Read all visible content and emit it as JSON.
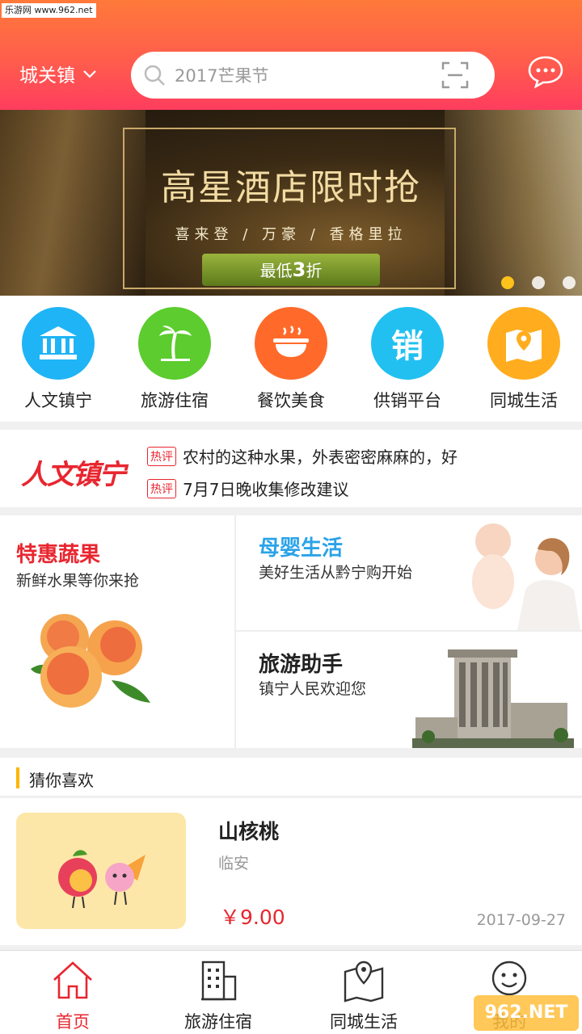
{
  "watermark_top": "乐游网 www.962.net",
  "header": {
    "city": "城关镇",
    "search_placeholder": "2017芒果节"
  },
  "banner": {
    "title": "高星酒店限时抢",
    "subtitle": "喜来登 / 万豪 / 香格里拉",
    "ribbon_prefix": "最低",
    "ribbon_num": "3",
    "ribbon_suffix": "折",
    "dots": 3,
    "active_dot": 1
  },
  "categories": [
    {
      "label": "人文镇宁",
      "icon": "bank-icon",
      "color": "#1fb4f5"
    },
    {
      "label": "旅游住宿",
      "icon": "palm-tree-icon",
      "color": "#5ccc2e"
    },
    {
      "label": "餐饮美食",
      "icon": "food-bowl-icon",
      "color": "#ff6a2a"
    },
    {
      "label": "供销平台",
      "icon": "sale-icon",
      "glyph": "销",
      "color": "#21c0f0"
    },
    {
      "label": "同城生活",
      "icon": "map-pin-icon",
      "color": "#ffad1f"
    }
  ],
  "news": {
    "brand": "人文镇宁",
    "items": [
      {
        "tag": "热评",
        "text": "农村的这种水果，外表密密麻麻的，好"
      },
      {
        "tag": "热评",
        "text": "7月7日晚收集修改建议"
      }
    ]
  },
  "promo": {
    "left": {
      "title": "特惠蔬果",
      "sub": "新鲜水果等你来抢",
      "title_color": "#e8262f"
    },
    "right_top": {
      "title": "母婴生活",
      "sub": "美好生活从黔宁购开始",
      "title_color": "#2aa3e8"
    },
    "right_bottom": {
      "title": "旅游助手",
      "sub": "镇宁人民欢迎您",
      "title_color": "#222222"
    }
  },
  "guess": {
    "label": "猜你喜欢"
  },
  "product": {
    "name": "山核桃",
    "location": "临安",
    "price": "￥9.00",
    "date": "2017-09-27"
  },
  "tabs": [
    {
      "label": "首页",
      "icon": "home-icon",
      "active": true
    },
    {
      "label": "旅游住宿",
      "icon": "building-icon",
      "active": false
    },
    {
      "label": "同城生活",
      "icon": "map-icon",
      "active": false
    },
    {
      "label": "我的",
      "icon": "smile-icon",
      "active": false
    }
  ],
  "watermark_bottom": "962.NET"
}
